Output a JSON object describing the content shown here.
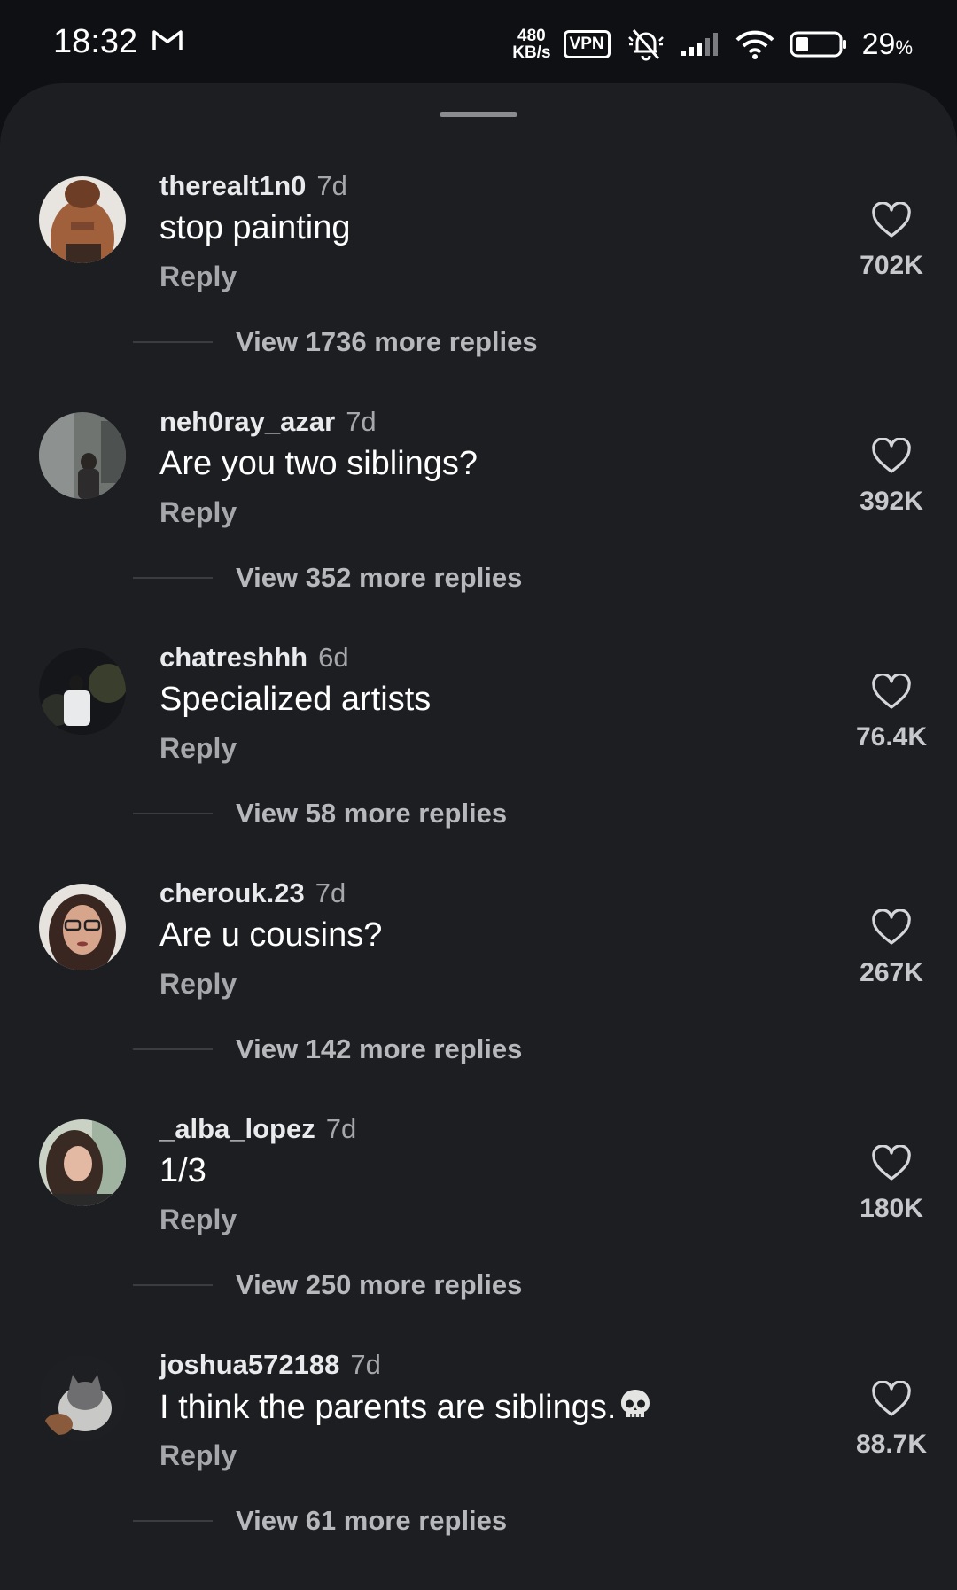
{
  "status_bar": {
    "time": "18:32",
    "notification_icon": "gmail-icon",
    "net_speed_value": "480",
    "net_speed_unit": "KB/s",
    "vpn_label": "VPN",
    "battery_percent": "29",
    "battery_symbol": "%"
  },
  "comments": [
    {
      "username": "therealt1n0",
      "age": "7d",
      "text": "stop painting",
      "reply_label": "Reply",
      "likes": "702K",
      "view_more": "View 1736 more replies"
    },
    {
      "username": "neh0ray_azar",
      "age": "7d",
      "text": "Are you  two siblings?",
      "reply_label": "Reply",
      "likes": "392K",
      "view_more": "View 352 more replies"
    },
    {
      "username": "chatreshhh",
      "age": "6d",
      "text": "Specialized artists",
      "reply_label": "Reply",
      "likes": "76.4K",
      "view_more": "View 58 more replies"
    },
    {
      "username": "cherouk.23",
      "age": "7d",
      "text": "Are u cousins?",
      "reply_label": "Reply",
      "likes": "267K",
      "view_more": "View 142 more replies"
    },
    {
      "username": "_alba_lopez",
      "age": "7d",
      "text": "1/3",
      "reply_label": "Reply",
      "likes": "180K",
      "view_more": "View 250 more replies"
    },
    {
      "username": "joshua572188",
      "age": "7d",
      "text": "I think the parents are siblings.",
      "text_emoji": "skull-emoji",
      "reply_label": "Reply",
      "likes": "88.7K",
      "view_more": "View 61 more replies"
    }
  ],
  "colors": {
    "background": "#0e1014",
    "sheet": "#1c1e22",
    "secondary_text": "#a5a7ab"
  }
}
